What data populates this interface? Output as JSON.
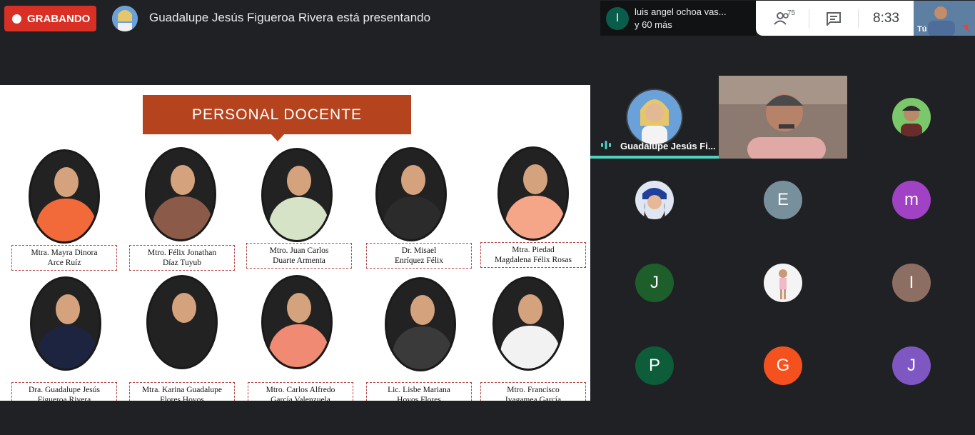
{
  "recording": {
    "label": "GRABANDO"
  },
  "presenter": {
    "text": "Guadalupe Jesús Figueroa Rivera está presentando"
  },
  "chat_notification": {
    "avatar_letter": "l",
    "line1": "luis angel ochoa vas...",
    "line2": "y 60 más"
  },
  "controls": {
    "people_count": "75",
    "time": "8:33",
    "self_label": "Tú"
  },
  "slide": {
    "title": "PERSONAL DOCENTE",
    "row1": [
      {
        "line1": "Mtra. Mayra Dinora",
        "line2": "Arce Ruíz",
        "body_color": "#f26a3a"
      },
      {
        "line1": "Mtro. Félix Jonathan",
        "line2": "Díaz Tuyub",
        "body_color": "#8c5a48"
      },
      {
        "line1": "Mtro. Juan Carlos",
        "line2": "Duarte Armenta",
        "body_color": "#d6e3c6"
      },
      {
        "line1": "Dr. Misael",
        "line2": "Enríquez Félix",
        "body_color": "#2b2b2b"
      },
      {
        "line1": "Mtra. Piedad",
        "line2": "Magdalena Félix Rosas",
        "body_color": "#f5a588"
      }
    ],
    "row2": [
      {
        "line1": "Dra. Guadalupe Jesús",
        "line2": "Figueroa Rivera",
        "body_color": "#1d2440"
      },
      {
        "line1": "Mtra. Karina Guadalupe",
        "line2": "Flores Hoyos",
        "body_color": "#222222"
      },
      {
        "line1": "Mtro. Carlos Alfredo",
        "line2": "García Valenzuela",
        "body_color": "#f08a72"
      },
      {
        "line1": "Lic. Lisbe Mariana",
        "line2": "Hoyos Flores",
        "body_color": "#3a3a3a"
      },
      {
        "line1": "Mtro. Francisco",
        "line2": "Iyagamea García",
        "body_color": "#f2f2f2"
      }
    ]
  },
  "gallery": {
    "speaker_name": "Guadalupe Jesús Fi...",
    "tiles": [
      {
        "letter": "E",
        "color": "#78909c"
      },
      {
        "letter": "m",
        "color": "#a142c4"
      },
      {
        "letter": "J",
        "color": "#1e5e2a"
      },
      {
        "letter": "I",
        "color": "#8d6e63"
      },
      {
        "letter": "P",
        "color": "#0d5c3a"
      },
      {
        "letter": "G",
        "color": "#f4511e"
      },
      {
        "letter": "J",
        "color": "#7e57c2"
      }
    ]
  }
}
